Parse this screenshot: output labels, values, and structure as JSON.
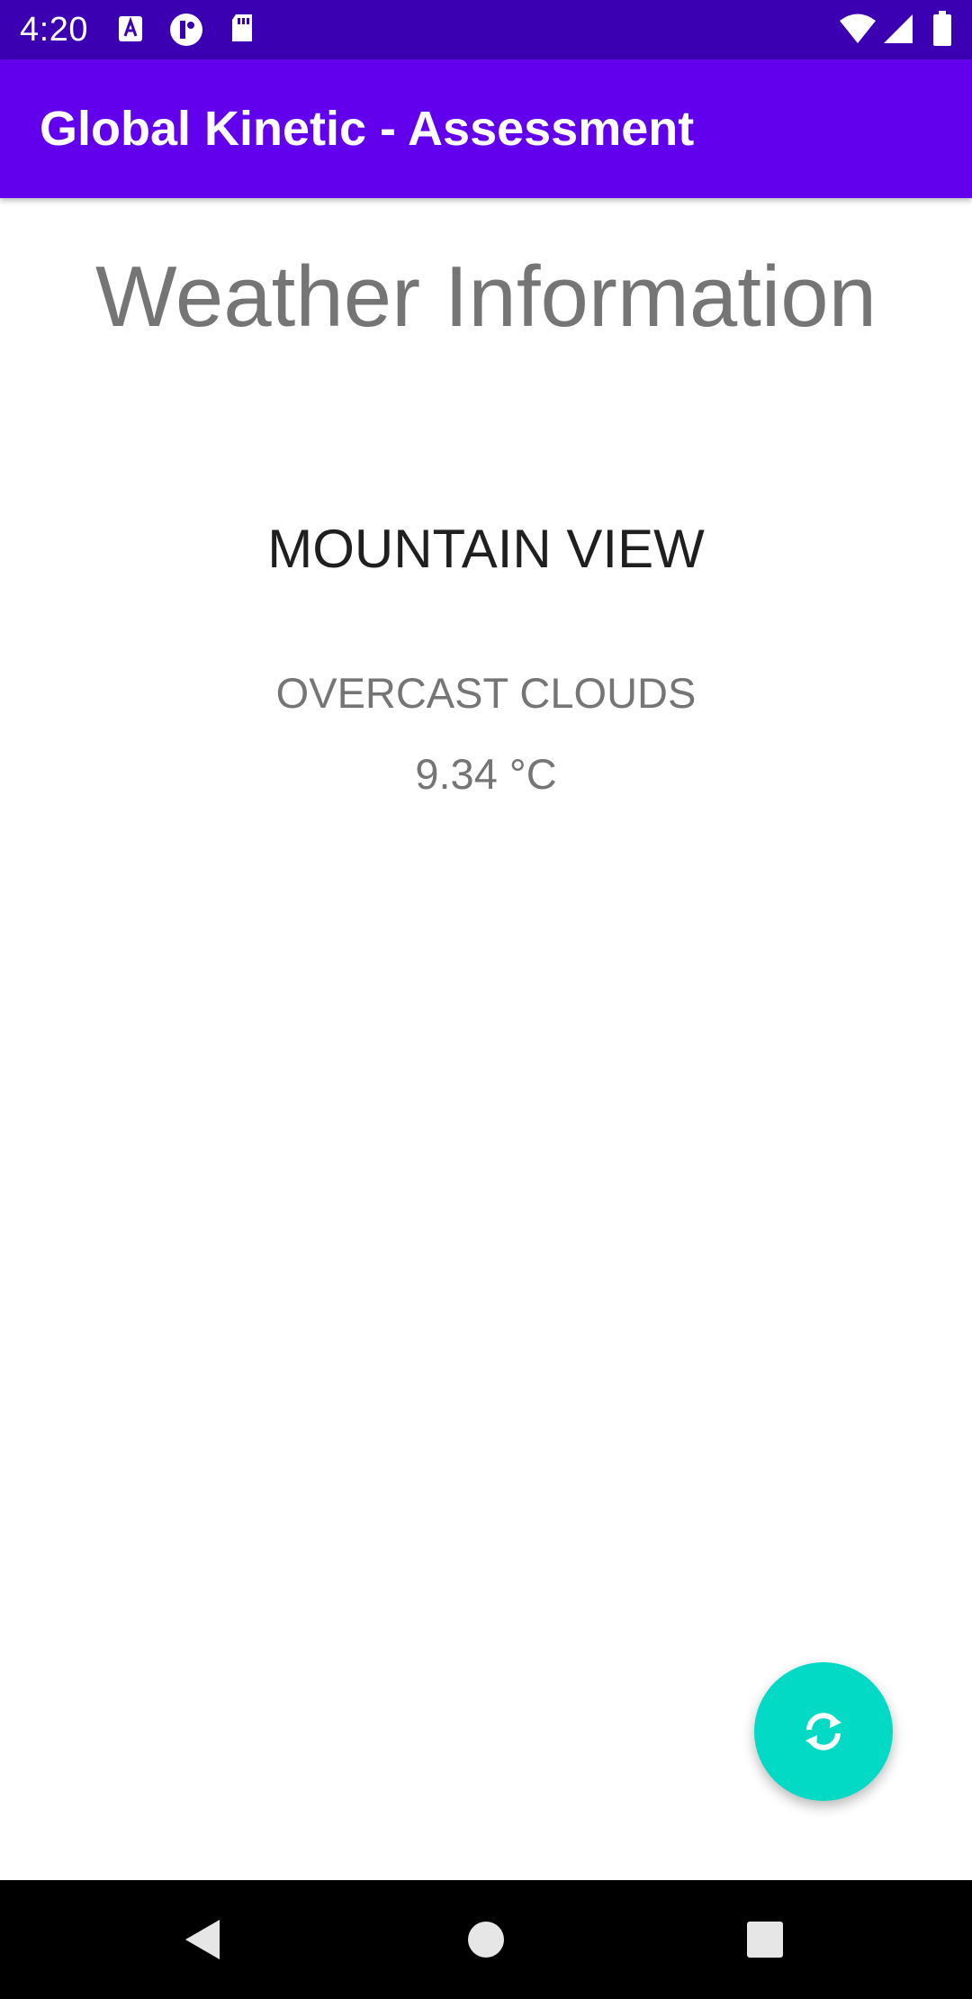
{
  "status_bar": {
    "time": "4:20",
    "icons": [
      "text-a-notification-icon",
      "t-notification-icon",
      "sd-card-icon",
      "wifi-icon",
      "cell-signal-icon",
      "battery-icon"
    ]
  },
  "app_bar": {
    "title": "Global Kinetic - Assessment",
    "color": "#6200ee"
  },
  "content": {
    "heading": "Weather Information",
    "city": "MOUNTAIN VIEW",
    "condition": "OVERCAST CLOUDS",
    "temperature": "9.34 °C"
  },
  "fab": {
    "icon": "refresh-icon",
    "color": "#03dac5"
  },
  "nav_bar": {
    "buttons": [
      "back",
      "home",
      "recents"
    ]
  },
  "colors": {
    "status_bar": "#3a00b1",
    "primary": "#6200ee",
    "accent": "#03dac5",
    "secondary_text": "#757575",
    "primary_text": "#1f1f1f"
  }
}
